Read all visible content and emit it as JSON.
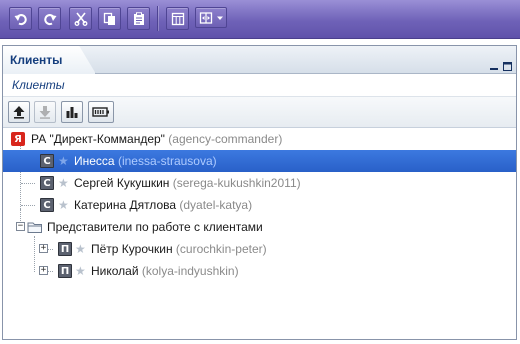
{
  "toolbar": {
    "buttons": [
      {
        "name": "undo-button",
        "icon": "undo-icon"
      },
      {
        "name": "redo-button",
        "icon": "redo-icon"
      },
      {
        "name": "cut-button",
        "icon": "scissors-icon"
      },
      {
        "name": "copy-button",
        "icon": "copy-icon"
      },
      {
        "name": "paste-button",
        "icon": "clipboard-icon"
      },
      {
        "name": "table-button",
        "icon": "table-icon"
      },
      {
        "name": "view-dropdown-button",
        "icon": "columns-icon"
      }
    ]
  },
  "panel": {
    "tab_label": "Клиенты",
    "subheader": "Клиенты",
    "tools": [
      {
        "name": "upload-button",
        "icon": "upload-icon",
        "enabled": true
      },
      {
        "name": "download-button",
        "icon": "download-icon",
        "enabled": false
      },
      {
        "name": "stats-button",
        "icon": "bar-chart-icon",
        "enabled": true
      },
      {
        "name": "settings-button",
        "icon": "battery-icon",
        "enabled": true
      }
    ]
  },
  "tree": {
    "root": {
      "icon_letter": "Я",
      "name": "РА \"Директ-Коммандер\"",
      "login": "(agency-commander)"
    },
    "clients": [
      {
        "icon_letter": "С",
        "name": "Инесса",
        "login": "(inessa-strausova)",
        "selected": true
      },
      {
        "icon_letter": "С",
        "name": "Сергей Кукушкин",
        "login": "(serega-kukushkin2011)",
        "selected": false
      },
      {
        "icon_letter": "С",
        "name": "Катерина Дятлова",
        "login": "(dyatel-katya)",
        "selected": false
      }
    ],
    "group": {
      "name": "Представители по работе с клиентами"
    },
    "representatives": [
      {
        "icon_letter": "П",
        "name": "Пётр Курочкин",
        "login": "(curochkin-peter)"
      },
      {
        "icon_letter": "П",
        "name": "Николай",
        "login": "(kolya-indyushkin)"
      }
    ]
  },
  "colors": {
    "selection": "#2960c8",
    "toolbar": "#6f62b8",
    "title": "#153e7e"
  }
}
